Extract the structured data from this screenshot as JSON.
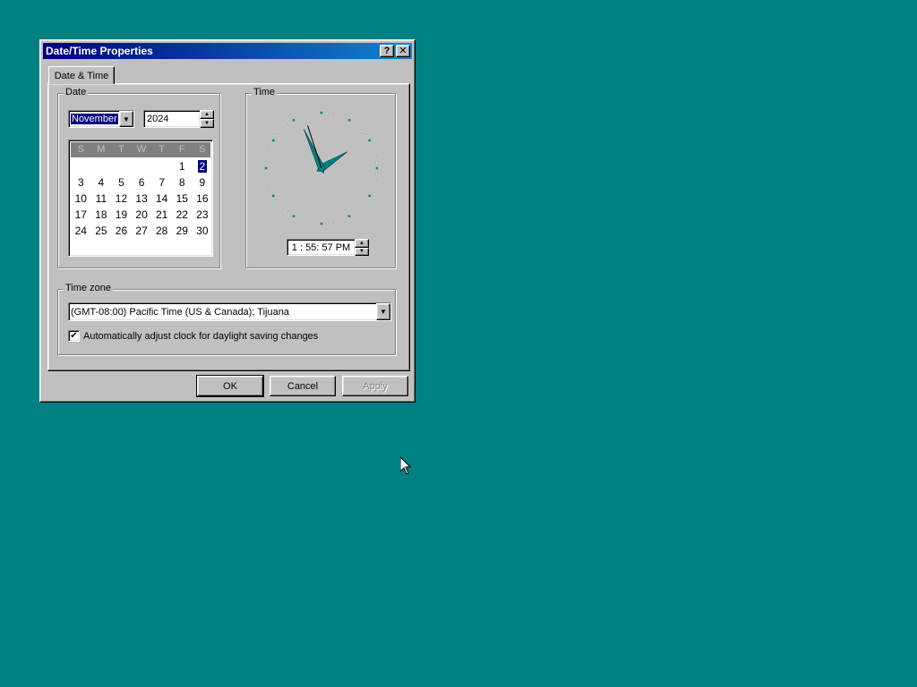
{
  "window": {
    "title": "Date/Time Properties",
    "help_glyph": "?",
    "close_glyph": "✕"
  },
  "tab": {
    "label": "Date & Time"
  },
  "date": {
    "group_label": "Date",
    "month": "November",
    "year": "2024",
    "weekdays": [
      "S",
      "M",
      "T",
      "W",
      "T",
      "F",
      "S"
    ],
    "days": [
      "",
      "",
      "",
      "",
      "",
      "1",
      "2",
      "3",
      "4",
      "5",
      "6",
      "7",
      "8",
      "9",
      "10",
      "11",
      "12",
      "13",
      "14",
      "15",
      "16",
      "17",
      "18",
      "19",
      "20",
      "21",
      "22",
      "23",
      "24",
      "25",
      "26",
      "27",
      "28",
      "29",
      "30"
    ],
    "selected_day": "2"
  },
  "time": {
    "group_label": "Time",
    "value": "1 : 55: 57 PM",
    "hour": 1,
    "minute": 55,
    "second": 57
  },
  "timezone": {
    "group_label": "Time zone",
    "selected": "(GMT-08:00) Pacific Time (US & Canada); Tijuana",
    "dst_label": "Automatically adjust clock for daylight saving changes",
    "dst_checked": true
  },
  "buttons": {
    "ok": "OK",
    "cancel": "Cancel",
    "apply": "Apply"
  },
  "colors": {
    "desktop": "#008080",
    "titlebar": "#000080",
    "clock_dots": "#008080"
  }
}
